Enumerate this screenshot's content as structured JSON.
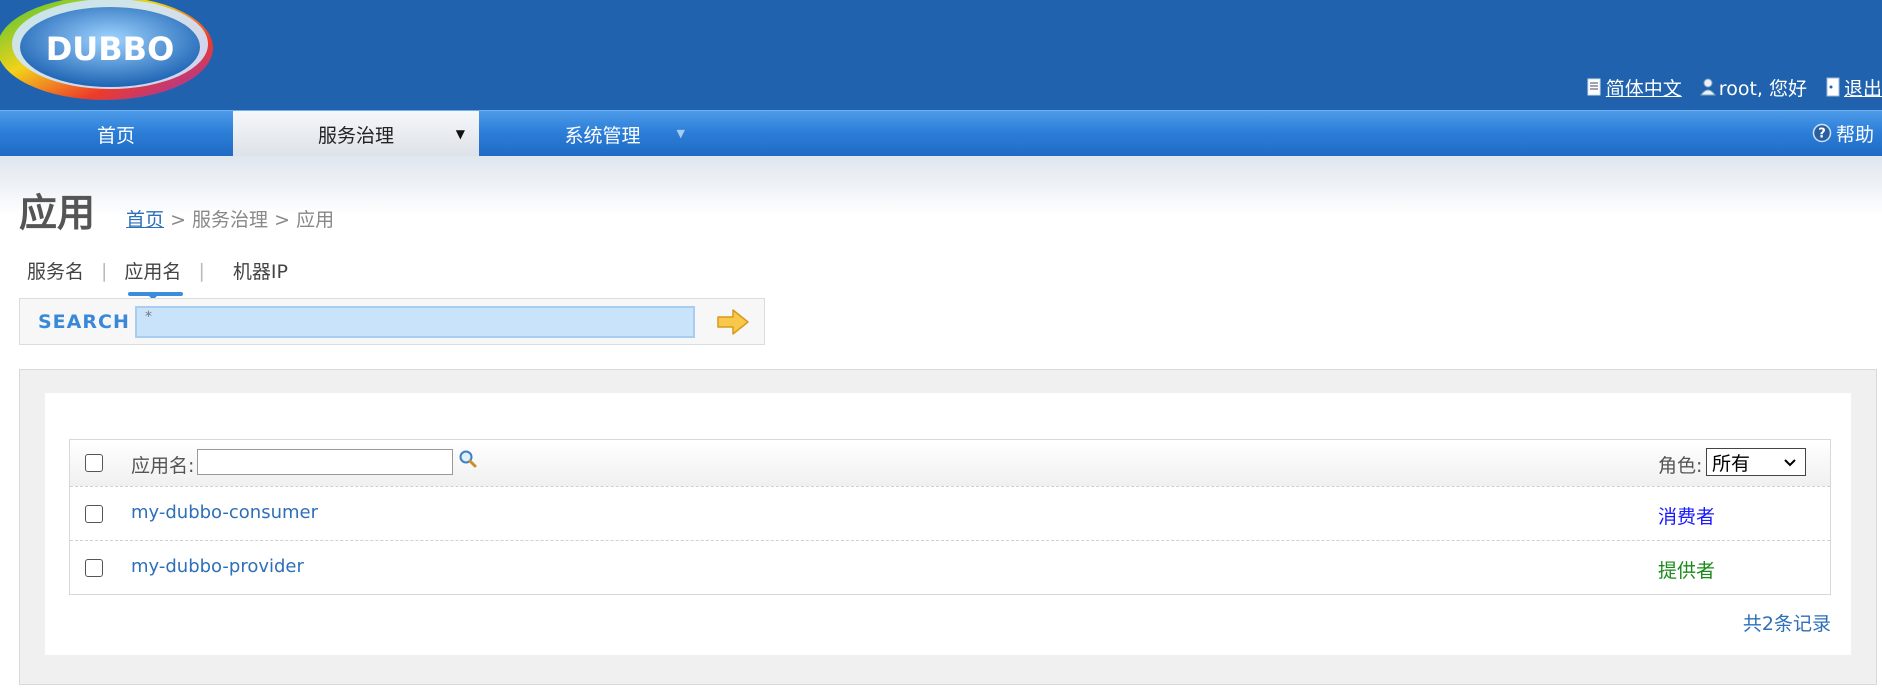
{
  "logo": {
    "text": "DUBBO"
  },
  "top_bar": {
    "language": "简体中文",
    "user_greeting": "root, 您好",
    "logout": "退出"
  },
  "nav": {
    "items": [
      {
        "label": "首页",
        "active": false
      },
      {
        "label": "服务治理",
        "active": true,
        "has_dropdown": true
      },
      {
        "label": "系统管理",
        "active": false,
        "has_dropdown": true
      }
    ],
    "help": "帮助"
  },
  "page": {
    "title": "应用",
    "breadcrumb": {
      "home": "首页",
      "separator": ">",
      "level1": "服务治理",
      "level2": "应用"
    }
  },
  "search": {
    "tabs": [
      "服务名",
      "应用名",
      "机器IP"
    ],
    "tab_separator": "|",
    "active_tab": "应用名",
    "label": "SEARCH",
    "value": "*"
  },
  "table": {
    "header": {
      "app_name_label": "应用名:",
      "app_name_value": "",
      "role_label": "角色:",
      "role_selected": "所有"
    },
    "rows": [
      {
        "app": "my-dubbo-consumer",
        "role": "消费者",
        "role_color": "#1a1aff"
      },
      {
        "app": "my-dubbo-provider",
        "role": "提供者",
        "role_color": "#1a8a1a"
      }
    ],
    "total": "共2条记录"
  },
  "colors": {
    "header_bg": "#2062ad",
    "nav_blue": "#2d7fd8",
    "link": "#2d6fb8",
    "consumer": "#1a1aff",
    "provider": "#1a8a1a"
  }
}
